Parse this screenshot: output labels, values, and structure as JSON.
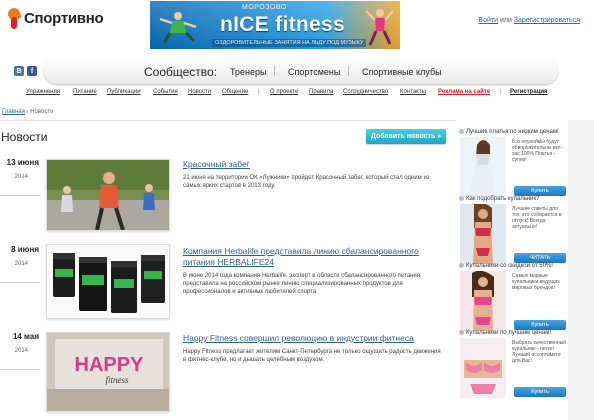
{
  "header": {
    "logo_text": "Спортивно",
    "banner": {
      "brand": "МОРОЗОВО",
      "title": "nICE fitness",
      "subtitle": "ОЗДОРОВИТЕЛЬНЫЕ ЗАНЯТИЯ НА ЛЬДУ ПОД МУЗЫКУ"
    },
    "auth": {
      "login": "Войти",
      "or": " или ",
      "register": "Зарегистрироваться"
    }
  },
  "social": {
    "vk": "В",
    "fb": "f"
  },
  "community": {
    "label": "Сообщество:",
    "links": [
      "Тренеры",
      "Спортсмены",
      "Спортивные клубы"
    ]
  },
  "nav": {
    "items": [
      "Упражнения",
      "Питание",
      "Публикации",
      "События",
      "Новости",
      "Общение",
      "|",
      "О проекте",
      "Правила",
      "Сотрудничество",
      "Контакты",
      "Реклама на сайте",
      "|",
      "Регистрация"
    ]
  },
  "breadcrumb": {
    "home": "Главная",
    "sep": " › ",
    "current": "Новости"
  },
  "page": {
    "title": "Новости",
    "add_button": "Добавить новость »"
  },
  "news": [
    {
      "date": "13 июня",
      "year": "2014",
      "title": "Красочный забег",
      "text": "21 июня на территории ОК «Лужники» пройдет Красочный забег, который стал одним из самых ярких стартов в 2013 году."
    },
    {
      "date": "8 июня",
      "year": "2014",
      "title": "Компания Herbalife представила линию сбалансированного питания HERBALIFE24",
      "text": "В июне 2014 года компания Herbalife, эксперт в области сбалансированного питания, представила на российском рынке линию специализированных продуктов для профессионалов и активных любителей спорта"
    },
    {
      "date": "14 мая",
      "year": "2014",
      "title": "Happy Fitness совершил революцию в индустрии фитнеса",
      "text": "Happy Fitness предлагает жителям Санкт-Петербурга не только ощущать радость движения в фитнес-клубе, но и дышать целебным воздухом.",
      "thumb_text": "HAPPY",
      "thumb_sub": "fitness"
    }
  ],
  "ads": [
    {
      "title": "Лучшие платья по низким ценам!",
      "text": "Бэз ноунеймы будут обворожительны вкл - хас 100% Платья - супер!",
      "button": "Купить"
    },
    {
      "title": "Как подобрать купальник?",
      "text": "Лучшие советы для тех, кто собирается в отпуск! Всегда актуально!",
      "button": "ЧИТАТЬ"
    },
    {
      "title": "Купальники со скидкой от 50%!",
      "text": "Самые модные купальники ведущих мировых брендов!",
      "button": "Купить"
    },
    {
      "title": "Купальники по лучшим ценам!",
      "text": "Выбрать качественный купальник - легко! Лучший ассортимент для Вас!",
      "button": "Купить"
    }
  ],
  "colors": {
    "accent": "#1aa6c0",
    "link": "#2b5f96",
    "ad_button": "#1a78c0",
    "promo": "#c8221a"
  }
}
